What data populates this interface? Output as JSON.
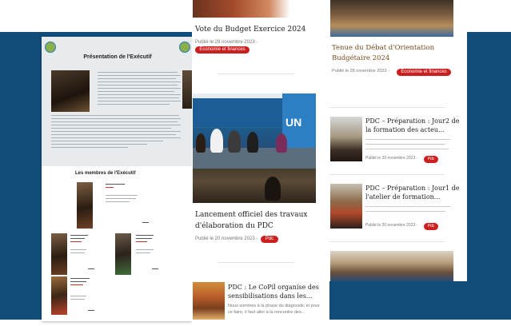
{
  "executif": {
    "title": "Présentation de l'Exécutif",
    "members_title": "Les membres de l'Exécutif"
  },
  "posts": [
    {
      "title": "Vote du Budget Exercice 2024",
      "date": "Publié le 28 novembre 2023 -",
      "category": "Economie et finances"
    },
    {
      "title": "Lancement officiel des travaux d'élaboration du PDC",
      "date": "Publié le 20 novembre 2023 -",
      "category": "Pdc"
    },
    {
      "title": "PDC : Le CoPil organise des sensibilisations dans les...",
      "excerpt": "Nous sommes à la phase du diagnostic et pour ce faire, il faut aller à la rencontre des..."
    },
    {
      "title": "Tenue du Débat d'Orientation Budgétaire 2024",
      "date": "Publié le 28 novembre 2023 -",
      "category": "Economie et finances"
    },
    {
      "title": "PDC – Préparation : Jour2 de la formation des acteu...",
      "date": "Publié le 20 novembre 2023 -",
      "category": "Pdc"
    },
    {
      "title": "PDC – Préparation : Jour1 de l'atelier de formation...",
      "date": "Publié le 20 novembre 2023 -",
      "category": "Pdc"
    }
  ],
  "colors": {
    "background_band": "#114d78",
    "pill": "#cc1f1f"
  }
}
